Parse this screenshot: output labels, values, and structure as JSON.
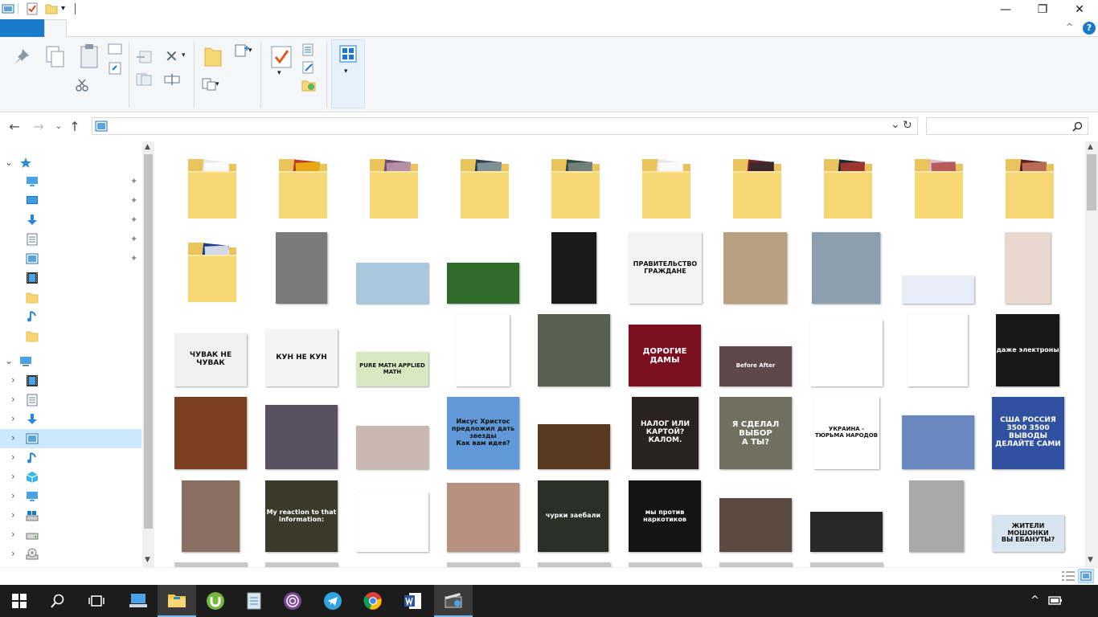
{
  "window": {
    "controls": {
      "minimize": "—",
      "maximize": "❐",
      "close": "✕"
    },
    "help_glyph": "?",
    "collapse_glyph": "^"
  },
  "address": {
    "path": "",
    "refresh_glyph": "↻",
    "dropdown_glyph": "⌄"
  },
  "search": {
    "placeholder": ""
  },
  "colors": {
    "accent": "#1979ca",
    "folder": "#f7d774",
    "selection": "#cce8ff",
    "taskbar": "#1c1c1c"
  },
  "nav": {
    "quick_access": [
      {
        "icon": "desktop-icon",
        "pinned": true
      },
      {
        "icon": "monitor-icon",
        "pinned": true
      },
      {
        "icon": "downloads-icon",
        "pinned": true
      },
      {
        "icon": "documents-icon",
        "pinned": true
      },
      {
        "icon": "pictures-icon",
        "pinned": true
      },
      {
        "icon": "videos-icon",
        "pinned": false
      },
      {
        "icon": "folder-icon",
        "pinned": false
      },
      {
        "icon": "music-icon",
        "pinned": false
      },
      {
        "icon": "folder-icon",
        "pinned": false
      }
    ],
    "this_pc": [
      {
        "icon": "videos-icon",
        "selected": false
      },
      {
        "icon": "documents-icon",
        "selected": false
      },
      {
        "icon": "downloads-icon",
        "selected": false
      },
      {
        "icon": "pictures-icon",
        "selected": true
      },
      {
        "icon": "music-icon",
        "selected": false
      },
      {
        "icon": "3d-objects-icon",
        "selected": false
      },
      {
        "icon": "desktop-icon",
        "selected": false
      },
      {
        "icon": "local-disk-icon",
        "selected": false
      },
      {
        "icon": "drive-icon",
        "selected": false
      },
      {
        "icon": "cd-drive-icon",
        "selected": false
      }
    ]
  },
  "thumbnails": {
    "r2": [
      "",
      "",
      "",
      "",
      "ПРАВИТЕЛЬСТВО\nГРАЖДАНЕ",
      "",
      "",
      "",
      ""
    ],
    "r3": [
      "ЧУВАК   НЕ ЧУВАК",
      "КУН   НЕ КУН",
      "PURE MATH  APPLIED MATH",
      "",
      "",
      "ДОРОГИЕ ДАМЫ",
      "Before  After",
      "",
      "",
      "даже электроны"
    ],
    "r4": [
      "",
      "",
      "",
      "Иисус Христос предложил дать звезды\nКак вам идея?",
      "",
      "НАЛОГ ИЛИ КАРТОЙ?\nКАЛОМ.",
      "Я СДЕЛАЛ ВЫБОР\nА ТЫ?",
      "УКРАИНА - ТЮРЬМА НАРОДОВ",
      "",
      "США  РОССИЯ\n3500  3500\nВЫВОДЫ ДЕЛАЙТЕ САМИ"
    ],
    "r5": [
      "",
      "My reaction to that information:",
      "",
      "",
      "чурки заебали",
      "мы против наркотиков",
      "",
      "",
      "",
      "ЖИТЕЛИ МОШОНКИ\nВЫ ЕБАНУТЫ?"
    ]
  }
}
